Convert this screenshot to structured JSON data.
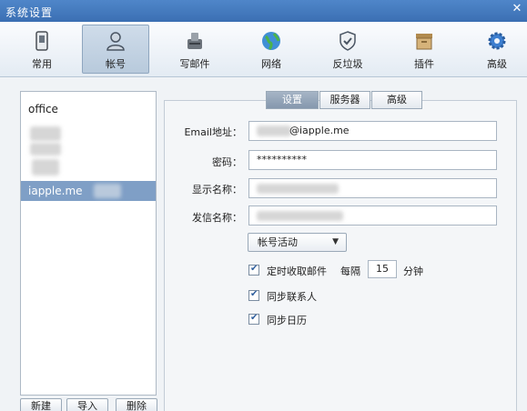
{
  "window": {
    "title": "系统设置",
    "close_glyph": "✕"
  },
  "toolbar": {
    "items": [
      {
        "label": "常用",
        "icon": "phone-icon"
      },
      {
        "label": "帐号",
        "icon": "user-icon"
      },
      {
        "label": "写邮件",
        "icon": "compose-icon"
      },
      {
        "label": "网络",
        "icon": "globe-icon"
      },
      {
        "label": "反垃圾",
        "icon": "shield-icon"
      },
      {
        "label": "插件",
        "icon": "plugin-box-icon"
      },
      {
        "label": "高级",
        "icon": "gear-icon"
      }
    ],
    "active_index": 1
  },
  "accounts": {
    "items": [
      "office",
      "iapple.me"
    ],
    "selected": "iapple.me",
    "buttons": {
      "new": "新建",
      "import": "导入",
      "delete": "删除"
    }
  },
  "tabs": {
    "items": [
      "设置",
      "服务器",
      "高级"
    ],
    "active": "设置"
  },
  "form": {
    "email_label": "Email地址：",
    "email_value": "@iapple.me",
    "password_label": "密码：",
    "password_value": "**********",
    "display_name_label": "显示名称：",
    "sender_name_label": "发信名称：",
    "account_status_select": "帐号活动",
    "auto_fetch_label": "定时收取邮件",
    "every_label": "每隔",
    "every_value": "15",
    "minutes_label": "分钟",
    "sync_contacts_label": "同步联系人",
    "sync_calendar_label": "同步日历"
  }
}
